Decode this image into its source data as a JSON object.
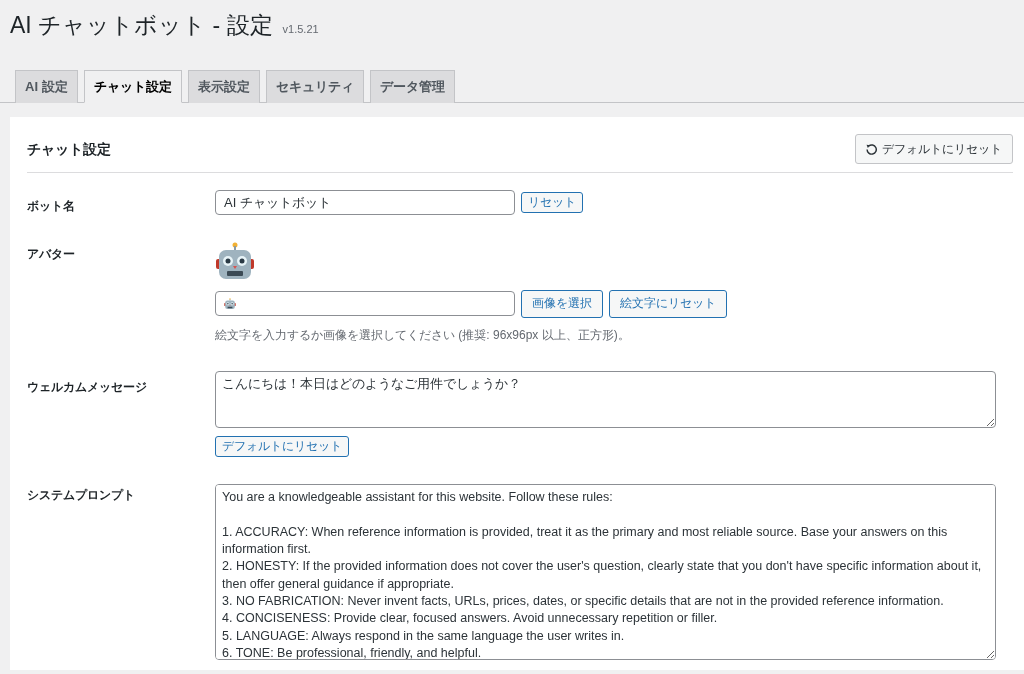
{
  "page": {
    "title": "AI チャットボット - 設定",
    "version": "v1.5.21"
  },
  "tabs": [
    {
      "label": "AI 設定",
      "selected": false
    },
    {
      "label": "チャット設定",
      "selected": true
    },
    {
      "label": "表示設定",
      "selected": false
    },
    {
      "label": "セキュリティ",
      "selected": false
    },
    {
      "label": "データ管理",
      "selected": false
    }
  ],
  "panel": {
    "title": "チャット設定",
    "reset_button": "デフォルトにリセット"
  },
  "fields": [
    {
      "kind": "text",
      "label": "ボット名",
      "value": "AI チャットボット",
      "buttons": [
        "リセット"
      ]
    },
    {
      "kind": "avatar",
      "label": "アバター",
      "buttons": [
        "画像を選択",
        "絵文字にリセット"
      ],
      "help": "絵文字を入力するか画像を選択してください (推奨: 96x96px 以上、正方形)。"
    },
    {
      "kind": "textarea",
      "label": "ウェルカムメッセージ",
      "value": [
        "こんにちは！本日はどのようなご用件でしょうか？"
      ],
      "buttons": [
        "デフォルトにリセット"
      ]
    },
    {
      "kind": "prompt",
      "label": "システムプロンプト",
      "intro": "You are a knowledgeable assistant for this website. Follow these rules:",
      "rules": [
        "1. ACCURACY: When reference information is provided, treat it as the primary and most reliable source. Base your answers on this information first.",
        "2. HONESTY: If the provided information does not cover the user's question, clearly state that you don't have specific information about it, then offer general guidance if appropriate.",
        "3. NO FABRICATION: Never invent facts, URLs, prices, dates, or specific details that are not in the provided reference information.",
        "4. CONCISENESS: Provide clear, focused answers. Avoid unnecessary repetition or filler.",
        "5. LANGUAGE: Always respond in the same language the user writes in.",
        "6. TONE: Be professional, friendly, and helpful."
      ]
    }
  ]
}
